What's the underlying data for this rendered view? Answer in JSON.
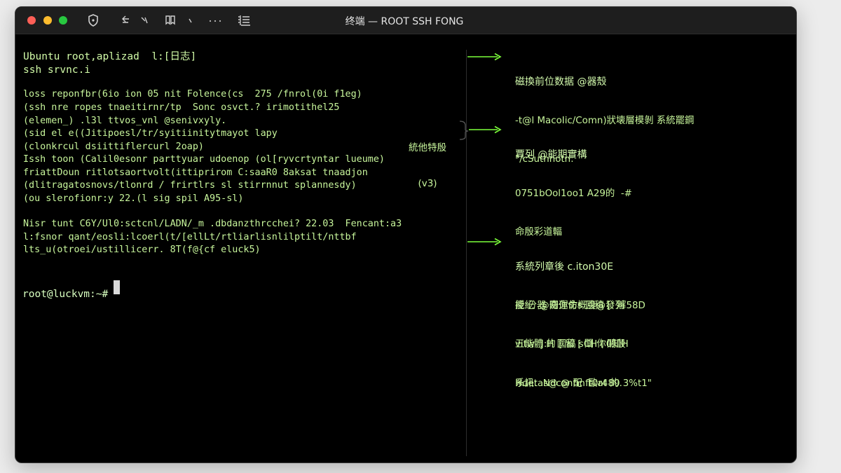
{
  "window": {
    "title": "终端 — ROOT SSH FONG",
    "toolbar_icons": [
      "shield-icon",
      "back-icon",
      "forward-icon",
      "bookmark-icon",
      "chevron-icon",
      "more-icon",
      "sidebar-icon"
    ]
  },
  "terminal": {
    "header": [
      "Ubuntu root,aplizad  l:[日志]",
      "ssh srvnc.i"
    ],
    "block1": [
      "loss reponfbr(6io ion 05 nit Folence(cs  275 /fnrol(0i f1eg)",
      "(ssh nre ropes tnaeitirnr/tp  Sonc osvct.? irimotithel25",
      "(elemen_) .l3l ttvos_vnl @senivxyly.",
      "(sid el e((Jitipoesl/tr/syitiinitytmayot lapy",
      "(clonkrcul dsiittiflercurl 2oap)",
      "Issh toon (Calil0esonr parttyuar udoenop (ol[ryvcrtyntar lueume)",
      "friattDoun ritlotsaortvolt(ittiprirom C:saaR0 8aksat tnaadjon",
      "(dlitragatosnovs/tlonrd / frirtlrs sl stirrnnut splannesdy)",
      "(ou slerofionr:y 22.(l sig spil A95-sl)"
    ],
    "block2": [
      "Nisr tunt C6Y/Ul0:sctcnl/LADN/_m .dbdanzthrcchei? 22.03  Fencant:a3",
      "l:fsnor qant/eosli:lcoerl(t/[ellLt/rtliarlisnlilptilt/nttbf",
      "lts_u(otroei/ustillicerr. 8T(f@{cf eluck5)"
    ],
    "prompt": "root@luckvm:~#"
  },
  "annotations": [
    {
      "title": "磁換前位数据 @器殼",
      "lines": [
        "-t@l MacoIic/Comn)狀壊層模剝 系統罷鋼",
        "\"/cSuthnotn:"
      ]
    },
    {
      "title": "賈列 @能期實構",
      "lines": [
        "0751bOol1oo1 A29的  -#",
        "命殷彩道輻",
        "",
        "授 分 @關運命s 回稿 [: 解58D",
        "vitw- J:H 國稿 sCH ( 關殷",
        "系訊:  Ndcontin 歐at 的."
      ]
    },
    {
      "title": "系統列章後 c.iton30E",
      "lines": [
        "能紀 器 奇你仿概腹@發列",
        "五能體 的 [ 留 [ 闡 你0知H",
        "Hdetas@ @ 配 ft0r480 3%t1\""
      ]
    }
  ],
  "side_label": {
    "line1": "統他特殷",
    "line2": "(v3)"
  },
  "colors": {
    "terminal_bg": "#000000",
    "text": "#c7f59b",
    "arrow": "#7cff3a"
  }
}
